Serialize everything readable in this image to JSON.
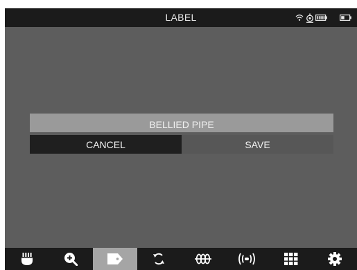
{
  "header": {
    "title": "LABEL",
    "status_icons": [
      "wifi-icon",
      "gps-icon",
      "battery-icon",
      "battery-icon"
    ]
  },
  "dialog": {
    "label_text": "BELLIED PIPE",
    "cancel_label": "CANCEL",
    "save_label": "SAVE"
  },
  "toolbar": {
    "items": [
      {
        "icon": "camera-head-icon",
        "active": false
      },
      {
        "icon": "zoom-in-icon",
        "active": false
      },
      {
        "icon": "tag-icon",
        "active": true
      },
      {
        "icon": "rotate-icon",
        "active": false
      },
      {
        "icon": "distance-counter-icon",
        "active": false
      },
      {
        "icon": "sonde-icon",
        "active": false
      },
      {
        "icon": "grid-menu-icon",
        "active": false
      },
      {
        "icon": "settings-gear-icon",
        "active": false
      }
    ]
  },
  "colors": {
    "background": "#5d5d5d",
    "bars": "#1b1b1b",
    "label_field": "#9a9a9a",
    "cancel_button": "#1f1f1f",
    "save_button": "#575757",
    "active_tool": "#a5a5a5"
  }
}
